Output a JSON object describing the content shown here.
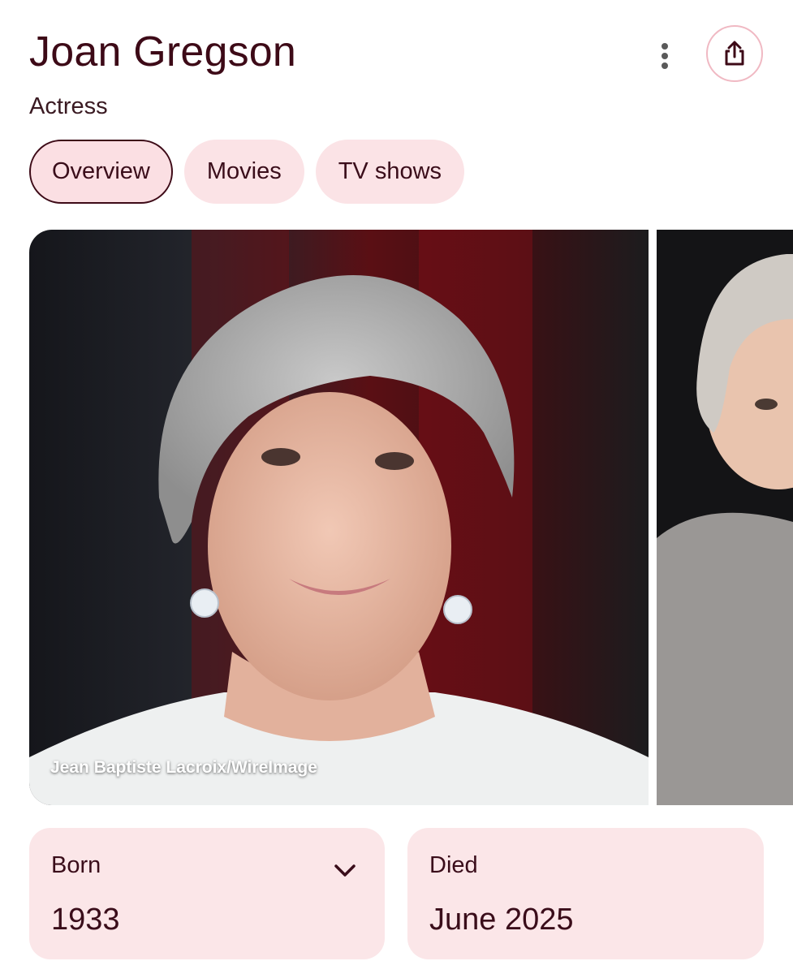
{
  "header": {
    "title": "Joan Gregson",
    "subtitle": "Actress",
    "more_icon": "more-vert-icon",
    "share_icon": "share-icon"
  },
  "tabs": [
    {
      "label": "Overview",
      "active": true
    },
    {
      "label": "Movies",
      "active": false
    },
    {
      "label": "TV shows",
      "active": false
    }
  ],
  "gallery": {
    "main_photo_credit": "Jean Baptiste Lacroix/WireImage"
  },
  "facts": {
    "born": {
      "label": "Born",
      "value": "1933",
      "icon": "chevron-down-icon"
    },
    "died": {
      "label": "Died",
      "value": "June 2025"
    }
  },
  "colors": {
    "title": "#3d0a17",
    "chip_bg": "#fbe3e6",
    "card_bg": "#fbe6e8",
    "share_border": "#f0b9c3"
  }
}
